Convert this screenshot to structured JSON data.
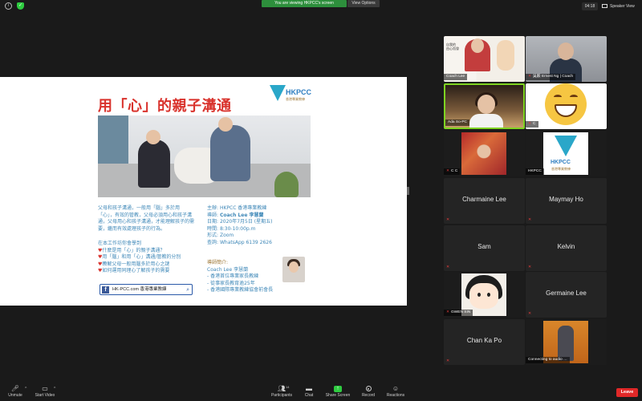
{
  "topbar": {
    "banner": "You are viewing HKPCC's screen",
    "view_options": "View Options",
    "time": "04:18",
    "speaker_view": "Speaker View"
  },
  "slide": {
    "title": "用「心」的親子溝通",
    "logo": {
      "brand": "HKPCC",
      "sub": "香港專業教練"
    },
    "intro": "父母和孩子溝通，一般用「腦」多於用「心」，有效的管教，父母必須用心和孩子溝通，父母用心和孩子溝通，才能理解孩子的需要，繼而有效處理孩子的行為。",
    "learn_heading": "在本工作坊你會學到",
    "learn_items": [
      "什麼是用「心」的親子溝通？",
      "用「腦」和用「心」溝通/管教的分別",
      "瞭解父母一般用腦多於用心之謎",
      "如何運用同理心了解孩子的需要"
    ],
    "details": [
      {
        "label": "主辦:",
        "value": "HKPCC 香港專業教練"
      },
      {
        "label": "導師:",
        "value": "Coach Lee 李慧蘭"
      },
      {
        "label": "日期:",
        "value": "2020年7月5日 (星期五)"
      },
      {
        "label": "時間:",
        "value": "8:30-10:00p.m"
      },
      {
        "label": "形式:",
        "value": "Zoom"
      },
      {
        "label": "查詢:",
        "value": "WhatsApp 6139 2626"
      }
    ],
    "bio_heading": "導師簡介:",
    "bio_name": "Coach Lee 李慧蘭",
    "bio_lines": [
      "- 香港首位專業家長教練",
      "- 從事家長教育逾25年",
      "- 香港國際專業教練協會前會長"
    ],
    "fb_text": "HK-PCC.com 香港專業教練"
  },
  "participants": [
    {
      "name": "Coach Lee",
      "type": "video"
    },
    {
      "name": "吳毅 Ernest Ng | Coach",
      "type": "video"
    },
    {
      "name": "Ada So-PC",
      "type": "video",
      "active": true
    },
    {
      "name": "C",
      "type": "video"
    },
    {
      "name": "C C",
      "type": "video"
    },
    {
      "name": "HKPCC",
      "type": "video"
    },
    {
      "name": "Charmaine Lee",
      "type": "name"
    },
    {
      "name": "Maymay Ho",
      "type": "name"
    },
    {
      "name": "Sam",
      "type": "name"
    },
    {
      "name": "Kelvin",
      "type": "name"
    },
    {
      "name": "GWEN SIN",
      "type": "video"
    },
    {
      "name": "Germaine Lee",
      "type": "name"
    },
    {
      "name": "Chan Ka Po",
      "type": "name"
    },
    {
      "name": "Connecting to audio",
      "type": "video"
    }
  ],
  "toolbar": {
    "unmute": "Unmute",
    "start_video": "Start Video",
    "participants": "Participants",
    "participants_count": "14",
    "chat": "Chat",
    "share_screen": "Share Screen",
    "record": "Record",
    "reactions": "Reactions",
    "leave": "Leave"
  },
  "colors": {
    "active_border": "#7ed321",
    "share_green": "#2ecc40",
    "leave_red": "#e02828",
    "muted_mic": "#e03b3b"
  }
}
